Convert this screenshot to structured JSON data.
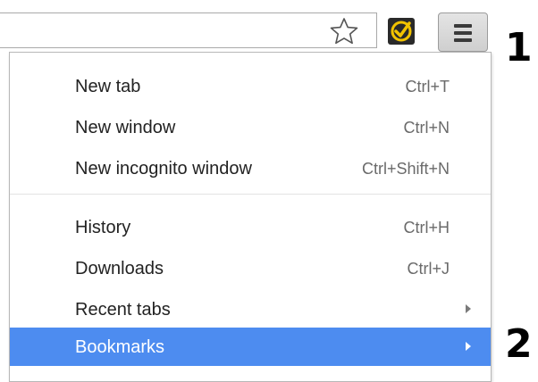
{
  "toolbar": {
    "star_icon": "star-outline-icon",
    "extension_icon": "norton-check-icon",
    "menu_icon": "hamburger-menu-icon"
  },
  "callouts": {
    "first": "1",
    "second": "2"
  },
  "menu": {
    "items": [
      {
        "label": "New tab",
        "shortcut": "Ctrl+T"
      },
      {
        "label": "New window",
        "shortcut": "Ctrl+N"
      },
      {
        "label": "New incognito window",
        "shortcut": "Ctrl+Shift+N"
      },
      {
        "label": "History",
        "shortcut": "Ctrl+H"
      },
      {
        "label": "Downloads",
        "shortcut": "Ctrl+J"
      },
      {
        "label": "Recent tabs",
        "submenu": true
      },
      {
        "label": "Bookmarks",
        "submenu": true,
        "highlighted": true
      }
    ]
  },
  "colors": {
    "highlight": "#4d8cf0",
    "extension_accent": "#f2c300"
  }
}
